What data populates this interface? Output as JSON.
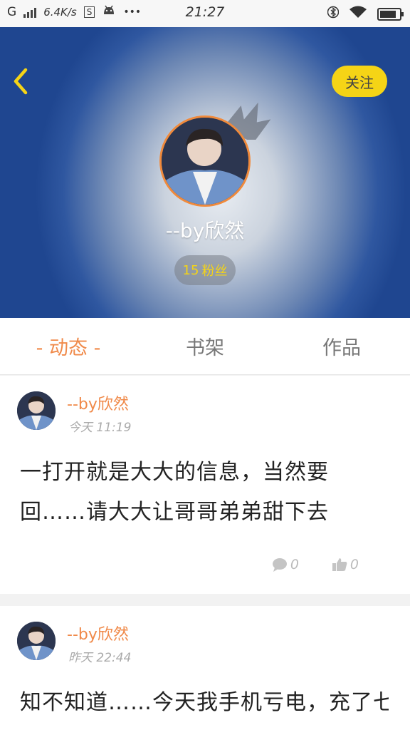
{
  "status_bar": {
    "network": "G",
    "speed": "6.4K/s",
    "sim_label": "S",
    "more": "•••",
    "time": "21:27",
    "battery_level": 0.85
  },
  "header": {
    "follow_label": "关注",
    "username": "--by欣然",
    "fans_count": "15",
    "fans_label": "粉丝"
  },
  "tabs": [
    {
      "label": "- 动态 -",
      "active": true
    },
    {
      "label": "书架",
      "active": false
    },
    {
      "label": "作品",
      "active": false
    }
  ],
  "posts": [
    {
      "author": "--by欣然",
      "time": "今天 11:19",
      "text": "一打开就是大大的信息，当然要回……请大大让哥哥弟弟甜下去",
      "comments": "0",
      "likes": "0"
    },
    {
      "author": "--by欣然",
      "time": "昨天 22:44",
      "text": "知不知道……今天我手机亏电，充了七"
    }
  ],
  "colors": {
    "accent": "#f08a4a",
    "follow_yellow": "#f5d416",
    "header_blue": "#2f57a0"
  }
}
